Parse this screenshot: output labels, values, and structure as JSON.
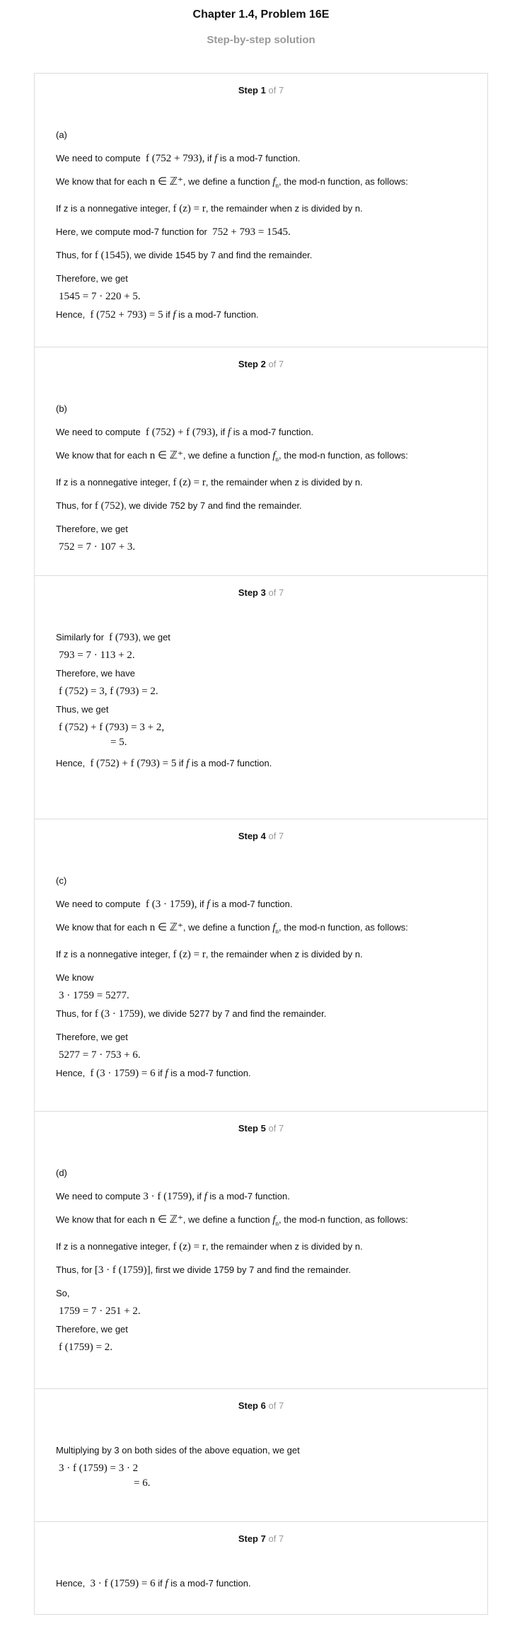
{
  "title": "Chapter 1.4, Problem 16E",
  "subtitle": "Step-by-step solution",
  "step_word": "Step",
  "of_word": "of 7",
  "steps": [
    {
      "num": "1",
      "part": "(a)",
      "lines": [
        "We need to compute",
        ", if",
        "is a mod-7 function.",
        "We know that for each",
        ", we define a function",
        ", the mod-n function, as follows:",
        "If z is a nonnegative integer,",
        ", the remainder when z is divided by n.",
        "Here, we compute mod-7 function for",
        "Thus, for",
        ", we divide 1545 by 7 and find the remainder.",
        "Therefore, we get",
        "Hence,",
        "if",
        "is a mod-7 function."
      ]
    },
    {
      "num": "2",
      "part": "(b)"
    },
    {
      "num": "3"
    },
    {
      "num": "4",
      "part": "(c)"
    },
    {
      "num": "5",
      "part": "(d)"
    },
    {
      "num": "6"
    },
    {
      "num": "7"
    }
  ],
  "text": {
    "need_compute": "We need to compute",
    "if": "if",
    "is_mod7": "is a mod-7 function.",
    "we_know_each": "We know that for each",
    "define_fn": ", we define a function",
    "mod_n_follows": ", the mod-n function, as follows:",
    "if_z": "If z is a nonnegative integer,",
    "remainder_z": ", the remainder when z is divided by n.",
    "here_compute": "Here, we compute mod-7 function for",
    "thus_for": "Thus, for",
    "divide_1545": ", we divide 1545 by 7 and find the remainder.",
    "therefore_get": "Therefore, we get",
    "hence": "Hence,",
    "divide_752": ", we divide 752 by 7 and find the remainder.",
    "similarly_for": "Similarly for",
    "we_get": ", we get",
    "therefore_have": "Therefore, we have",
    "thus_we_get": "Thus, we get",
    "we_know": "We know",
    "divide_5277": ", we divide 5277 by 7 and find the remainder.",
    "first_divide_1759": ", first we divide 1759 by 7 and find the remainder.",
    "so": "So,",
    "multiplying": "Multiplying by 3 on both sides of the above equation, we get"
  },
  "math": {
    "f_752_793": "f (752 + 793),",
    "f": "f",
    "n_in_z": "n ∈ ℤ⁺",
    "f_n": "f",
    "f_n_z": "f (z) = r",
    "sum_1545": "752 + 793 = 1545.",
    "f7_1545": "f (1545)",
    "eq_1545": "1545 = 7 · 220 + 5.",
    "res_a": "f (752 + 793) = 5",
    "f752_plus_f793": "f (752) + f (793),",
    "f7_752": "f (752)",
    "eq_752": "752 = 7 · 107 + 3.",
    "f7_793": "f (793)",
    "eq_793": "793 = 7 · 113 + 2.",
    "vals": "f (752) = 3, f (793) = 2.",
    "sum_line1": "f (752) + f (793) = 3 + 2,",
    "sum_line2": "= 5.",
    "res_b": "f (752) + f (793) = 5",
    "f_3x1759": "f (3 · 1759),",
    "prod_5277": "3 · 1759 = 5277.",
    "f_3x1759_b": "f (3 · 1759)",
    "eq_5277": "5277 = 7 · 753 + 6.",
    "res_c": "f (3 · 1759) = 6",
    "three_f1759": "3 · f (1759),",
    "bracket_3f1759": "[3 · f (1759)]",
    "eq_1759": "1759 = 7 · 251 + 2.",
    "f1759_2": "f (1759) = 2.",
    "mult_line1": "3 · f (1759) = 3 · 2",
    "mult_line2": "= 6.",
    "res_d": "3 · f (1759) = 6"
  }
}
